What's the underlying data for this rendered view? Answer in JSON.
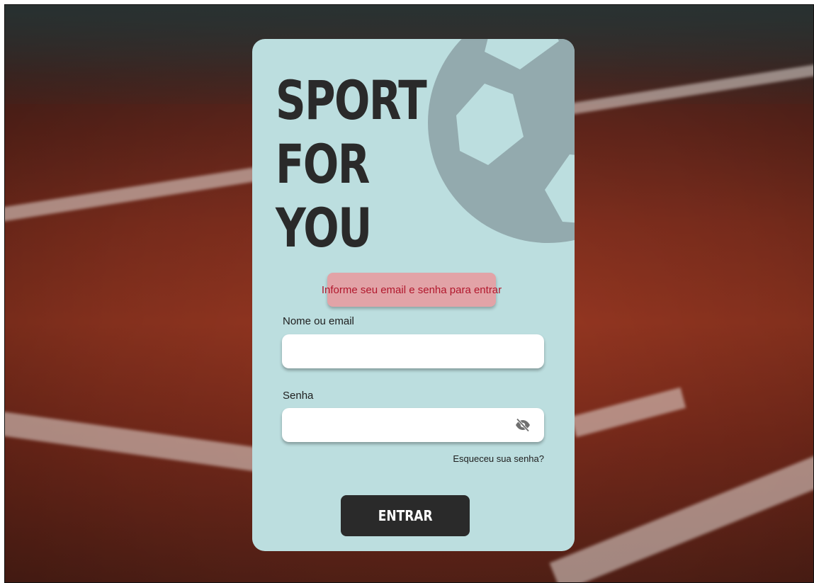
{
  "brand": {
    "line1": "SPORT",
    "line2": "FOR",
    "line3": "YOU"
  },
  "alert": {
    "message": "Informe seu email e senha para entrar"
  },
  "form": {
    "username_label": "Nome ou email",
    "username_value": "",
    "password_label": "Senha",
    "password_value": "",
    "forgot_link": "Esqueceu sua senha?",
    "submit_label": "ENTRAR"
  },
  "icons": {
    "ball": "soccer-ball-icon",
    "password_toggle": "eye-slash-icon"
  },
  "colors": {
    "card": "#bcdedf",
    "ball": "#93aaae",
    "alert_bg": "#e2a3a7",
    "alert_text": "#b1172c",
    "button": "#2a2a2a",
    "title": "#2a2a2a"
  }
}
